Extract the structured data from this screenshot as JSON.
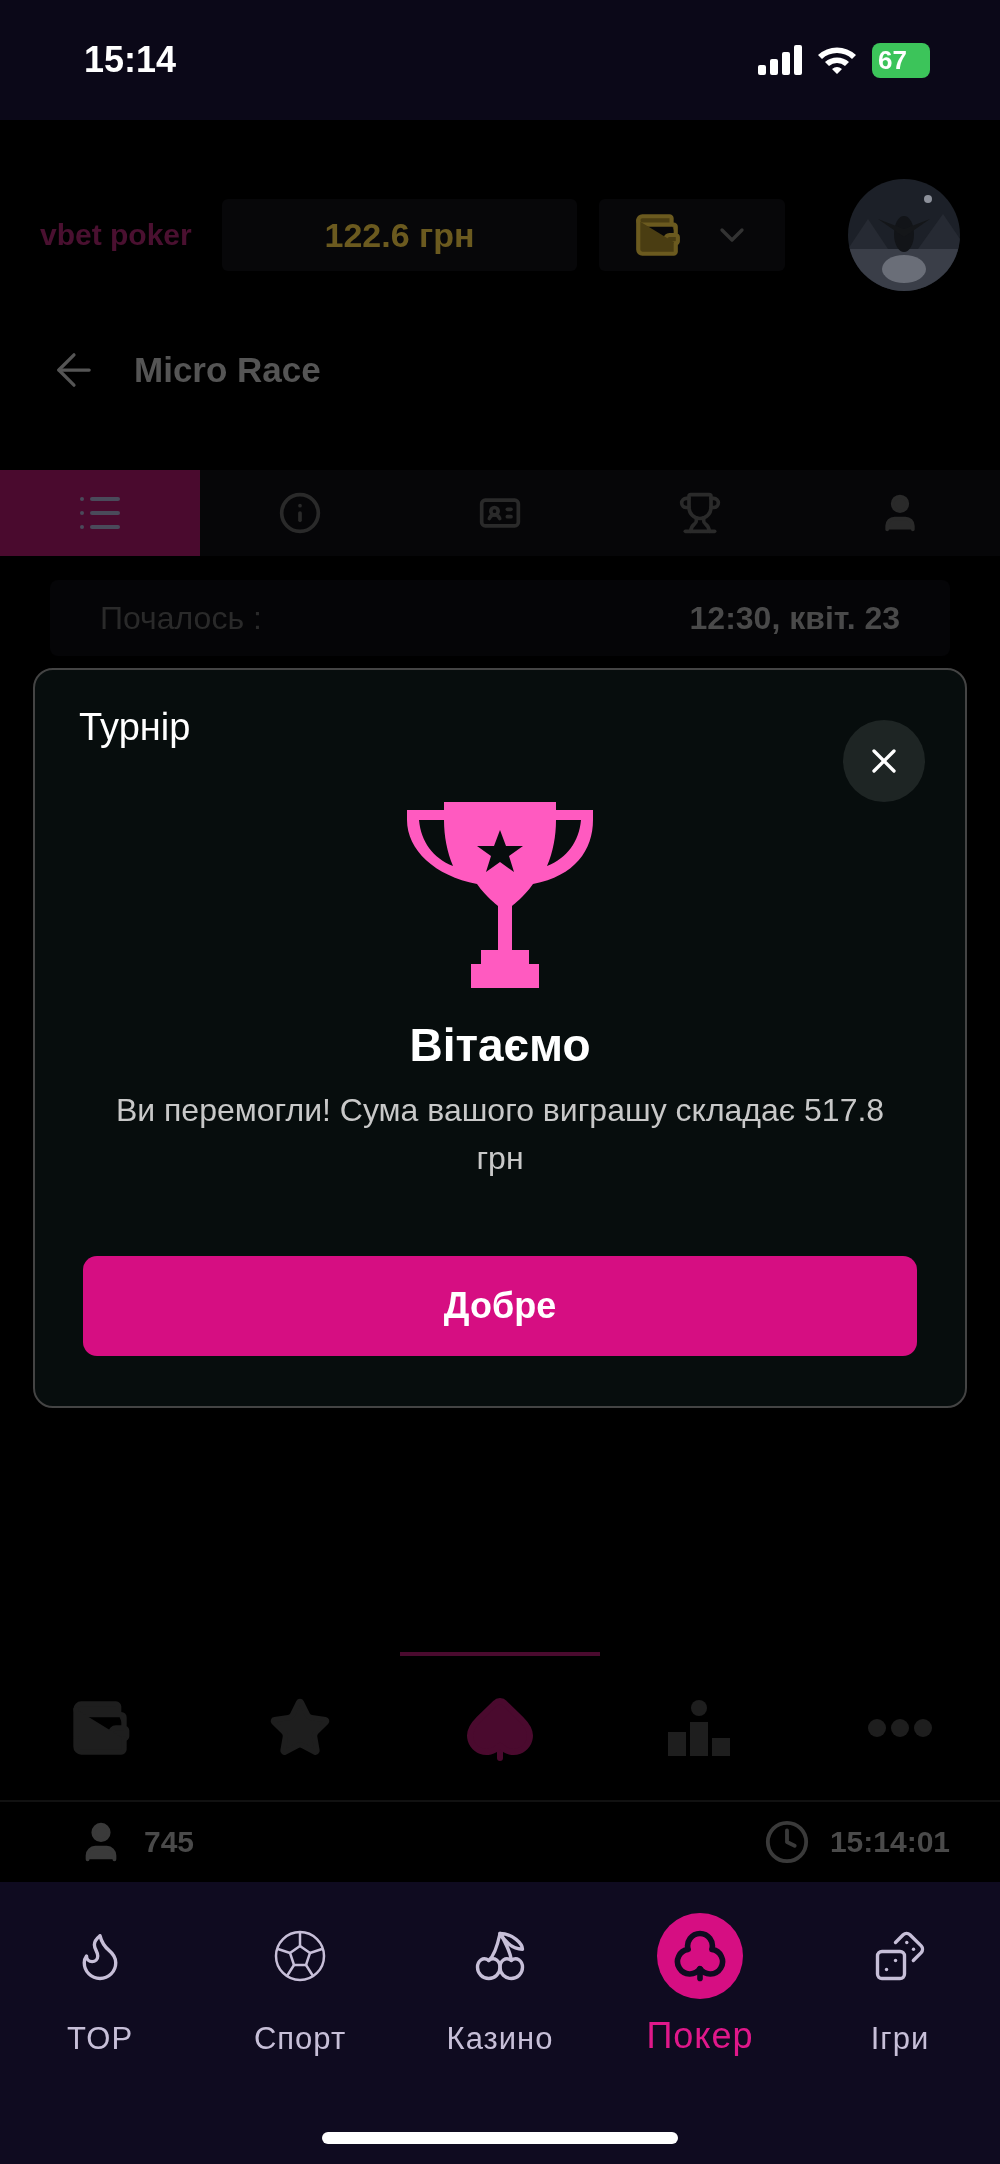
{
  "status_bar": {
    "time": "15:14",
    "battery": "67"
  },
  "header": {
    "logo": "vbet poker",
    "balance": "122.6 грн"
  },
  "page_title": "Micro Race",
  "tabs": [
    {
      "selected": true
    },
    {
      "selected": false
    },
    {
      "selected": false
    },
    {
      "selected": false
    },
    {
      "selected": false
    }
  ],
  "info_row": {
    "label": "Почалось :",
    "value": "12:30, квіт. 23"
  },
  "modal": {
    "title": "Турнір",
    "heading": "Вітаємо",
    "message": "Ви перемогли! Сума вашого виграшу складає 517.8 грн",
    "button": "Добре"
  },
  "game_nav": [
    {
      "selected": false
    },
    {
      "selected": false
    },
    {
      "selected": true
    },
    {
      "selected": false
    },
    {
      "selected": false
    }
  ],
  "footer": {
    "players": "745",
    "clock": "15:14:01"
  },
  "bottom_nav": [
    {
      "label": "TOP",
      "selected": false
    },
    {
      "label": "Спорт",
      "selected": false
    },
    {
      "label": "Казино",
      "selected": false
    },
    {
      "label": "Покер",
      "selected": true
    },
    {
      "label": "Ігри",
      "selected": false
    }
  ]
}
